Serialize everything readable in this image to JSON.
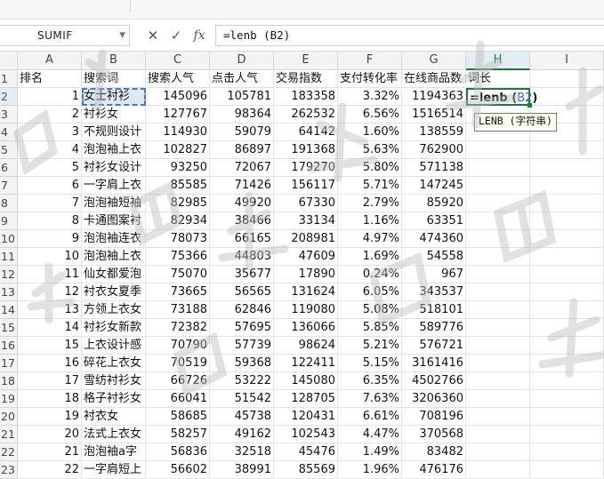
{
  "name_box": {
    "value": "SUMIF"
  },
  "formula_bar": {
    "cancel_symbol": "✕",
    "confirm_symbol": "✓",
    "fx_label": "fx",
    "formula": "=lenb (B2)"
  },
  "columns": [
    "A",
    "B",
    "C",
    "D",
    "E",
    "F",
    "G",
    "H",
    "I"
  ],
  "active_column": "H",
  "headers": [
    "排名",
    "搜索词",
    "搜索人气",
    "点击人气",
    "交易指数",
    "支付转化率",
    "在线商品数",
    "词长"
  ],
  "rows": [
    {
      "rank": "1",
      "term": "女士衬衫",
      "search": "145096",
      "click": "105781",
      "trade": "183358",
      "conv": "3.32%",
      "items": "1194363"
    },
    {
      "rank": "2",
      "term": "衬衫女",
      "search": "127767",
      "click": "98364",
      "trade": "262532",
      "conv": "6.56%",
      "items": "1516514"
    },
    {
      "rank": "3",
      "term": "不规则设计",
      "search": "114930",
      "click": "59079",
      "trade": "64142",
      "conv": "1.60%",
      "items": "138559"
    },
    {
      "rank": "4",
      "term": "泡泡袖上衣",
      "search": "102827",
      "click": "86897",
      "trade": "191368",
      "conv": "5.63%",
      "items": "762900"
    },
    {
      "rank": "5",
      "term": "衬衫女设计",
      "search": "93250",
      "click": "72067",
      "trade": "179270",
      "conv": "5.80%",
      "items": "571138"
    },
    {
      "rank": "6",
      "term": "一字肩上衣",
      "search": "85585",
      "click": "71426",
      "trade": "156117",
      "conv": "5.71%",
      "items": "147245"
    },
    {
      "rank": "7",
      "term": "泡泡袖短袖",
      "search": "82985",
      "click": "49920",
      "trade": "67330",
      "conv": "2.79%",
      "items": "85920"
    },
    {
      "rank": "8",
      "term": "卡通图案衬",
      "search": "82934",
      "click": "38466",
      "trade": "33134",
      "conv": "1.16%",
      "items": "63351"
    },
    {
      "rank": "9",
      "term": "泡泡袖连衣",
      "search": "78073",
      "click": "66165",
      "trade": "208981",
      "conv": "4.97%",
      "items": "474360"
    },
    {
      "rank": "10",
      "term": "泡泡袖上衣",
      "search": "75366",
      "click": "44803",
      "trade": "47609",
      "conv": "1.69%",
      "items": "54558"
    },
    {
      "rank": "11",
      "term": "仙女都爱泡",
      "search": "75070",
      "click": "35677",
      "trade": "17890",
      "conv": "0.24%",
      "items": "967"
    },
    {
      "rank": "12",
      "term": "衬衣女夏季",
      "search": "73665",
      "click": "56565",
      "trade": "131624",
      "conv": "6.05%",
      "items": "343537"
    },
    {
      "rank": "13",
      "term": "方领上衣女",
      "search": "73188",
      "click": "62846",
      "trade": "119080",
      "conv": "5.08%",
      "items": "518101"
    },
    {
      "rank": "14",
      "term": "衬衫女新款",
      "search": "72382",
      "click": "57695",
      "trade": "136066",
      "conv": "5.85%",
      "items": "589776"
    },
    {
      "rank": "15",
      "term": "上衣设计感",
      "search": "70790",
      "click": "57739",
      "trade": "98624",
      "conv": "5.21%",
      "items": "576721"
    },
    {
      "rank": "16",
      "term": "碎花上衣女",
      "search": "70519",
      "click": "59368",
      "trade": "122411",
      "conv": "5.15%",
      "items": "3161416"
    },
    {
      "rank": "17",
      "term": "雪纺衬衫女",
      "search": "66726",
      "click": "53222",
      "trade": "145080",
      "conv": "6.35%",
      "items": "4502766"
    },
    {
      "rank": "18",
      "term": "格子衬衫女",
      "search": "66041",
      "click": "51542",
      "trade": "128705",
      "conv": "7.63%",
      "items": "3206360"
    },
    {
      "rank": "19",
      "term": "衬衣女",
      "search": "58685",
      "click": "45738",
      "trade": "120431",
      "conv": "6.61%",
      "items": "708196"
    },
    {
      "rank": "20",
      "term": "法式上衣女",
      "search": "58257",
      "click": "49162",
      "trade": "102543",
      "conv": "4.47%",
      "items": "370568"
    },
    {
      "rank": "21",
      "term": "泡泡袖a字",
      "search": "56836",
      "click": "32518",
      "trade": "45476",
      "conv": "1.49%",
      "items": "83482"
    },
    {
      "rank": "22",
      "term": "一字肩短上",
      "search": "56602",
      "click": "38991",
      "trade": "85569",
      "conv": "1.96%",
      "items": "476176"
    }
  ],
  "active_cell": {
    "prefix": "=lenb (",
    "ref": "B2",
    "suffix": ")"
  },
  "tooltip": {
    "text": "LENB (字符串)"
  },
  "colors": {
    "accent_green": "#1a7a3c",
    "ref_blue": "#3466c0",
    "selection_fill": "#dfe9f6"
  }
}
